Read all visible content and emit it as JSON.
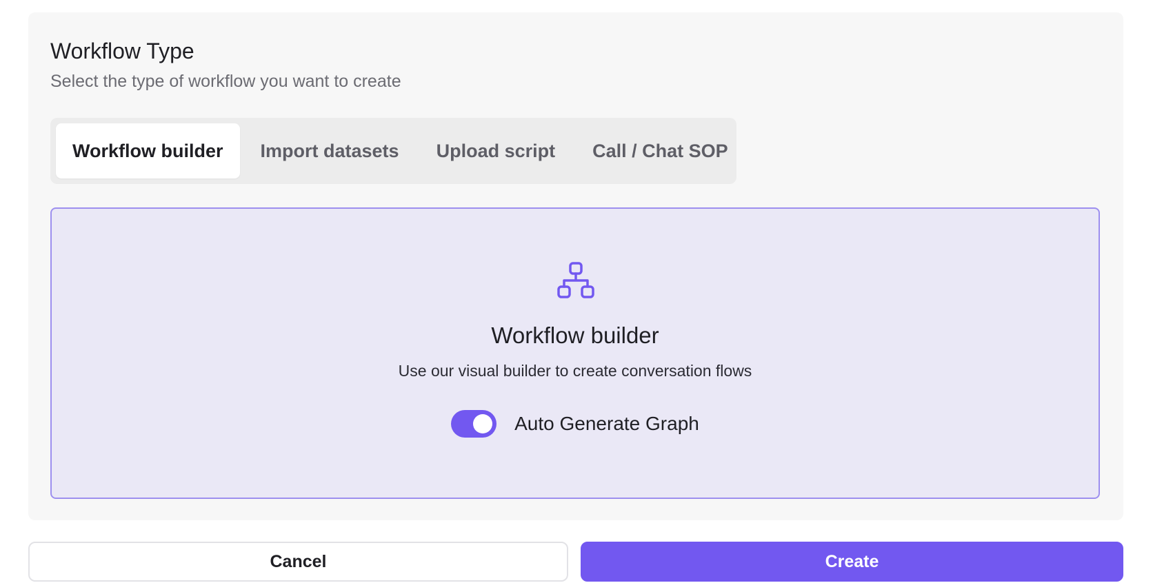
{
  "section": {
    "title": "Workflow Type",
    "subtitle": "Select the type of workflow you want to create"
  },
  "tabs": [
    {
      "label": "Workflow builder",
      "active": true
    },
    {
      "label": "Import datasets",
      "active": false
    },
    {
      "label": "Upload script",
      "active": false
    },
    {
      "label": "Call / Chat SOP",
      "active": false
    }
  ],
  "card": {
    "icon": "workflow-hierarchy-icon",
    "title": "Workflow builder",
    "description": "Use our visual builder to create conversation flows",
    "toggle_label": "Auto Generate Graph",
    "toggle_on": true
  },
  "actions": {
    "cancel_label": "Cancel",
    "create_label": "Create"
  },
  "colors": {
    "accent": "#7258f0",
    "card_bg": "#eae8f6",
    "card_border": "#9d8fef",
    "panel_bg": "#f7f7f7"
  }
}
